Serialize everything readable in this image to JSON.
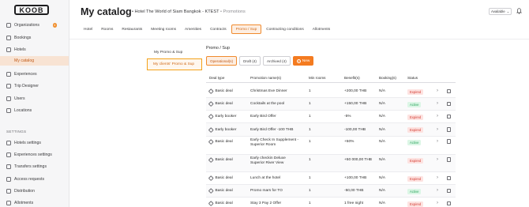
{
  "app": {
    "logo_text": "KOOB"
  },
  "sidebar": {
    "items": [
      {
        "label": "Organizations",
        "icon": "building-icon",
        "badge": "4"
      },
      {
        "label": "Bookings",
        "icon": "calendar-icon"
      },
      {
        "label": "Hotels",
        "icon": "hotel-icon"
      },
      {
        "label": "My catalog",
        "icon": "",
        "active": true
      },
      {
        "label": "Experiences",
        "icon": "compass-icon"
      },
      {
        "label": "Trip Designer",
        "icon": "map-icon"
      },
      {
        "label": "Users",
        "icon": "user-icon"
      },
      {
        "label": "Locations",
        "icon": "pin-icon"
      }
    ],
    "settings_label": "SETTINGS",
    "settings_items": [
      {
        "label": "Hotels settings",
        "icon": "hotel-settings-icon"
      },
      {
        "label": "Experiences settings",
        "icon": "experience-settings-icon"
      },
      {
        "label": "Transfers settings",
        "icon": "transfer-icon"
      },
      {
        "label": "Access requests",
        "icon": "key-icon"
      },
      {
        "label": "Distribution",
        "icon": "share-icon"
      },
      {
        "label": "Allotments",
        "icon": "allotment-icon"
      }
    ]
  },
  "header": {
    "title": "My catalog",
    "subtitle_prefix": "• Hotel The World of Siam Bangkok - KTEST",
    "subtitle_suffix": "• Promotions",
    "availability": "Available",
    "bell_icon": "bell-icon"
  },
  "tabs": [
    "Hotel",
    "Rooms",
    "Restaurants",
    "Meeting rooms",
    "Amenities",
    "Contracts",
    "Promo / Sup",
    "Contracting conditions",
    "Allotments"
  ],
  "active_tab": "Promo / Sup",
  "subnav": {
    "item1": "My Promo & Sup",
    "item2": "My clients' Promo & Sup"
  },
  "section": {
    "title": "Promo / Sup",
    "filters": [
      "Operational(s)",
      "Draft (4)",
      "Archived (4)"
    ],
    "new_button": "New"
  },
  "table": {
    "columns": [
      "Deal type",
      "Promotion name(s)",
      "Min rooms",
      "Benefit(s)",
      "Booking(s)",
      "Status"
    ],
    "rows": [
      {
        "deal": "Basic deal",
        "name": "Christmas Eve Dinner",
        "min": "1",
        "benefit": "+200,00 THB",
        "bookings": "N/A",
        "status": "Expired"
      },
      {
        "deal": "Basic deal",
        "name": "Cocktails at the pool",
        "min": "1",
        "benefit": "+150,00 THB",
        "bookings": "N/A",
        "status": "Active"
      },
      {
        "deal": "Early booker",
        "name": "Early Bird Offer",
        "min": "1",
        "benefit": "-5%",
        "bookings": "N/A",
        "status": "Expired"
      },
      {
        "deal": "Early booker",
        "name": "Early Bird Offer -100 THB",
        "min": "1",
        "benefit": "-100,00 THB",
        "bookings": "N/A",
        "status": "Expired"
      },
      {
        "deal": "Basic deal",
        "name": "Early Check In Supplement -",
        "name2": "Superior Room",
        "min": "1",
        "benefit": "+50%",
        "bookings": "N/A",
        "status": "Active"
      },
      {
        "deal": "Basic deal",
        "name": "Early checkin Deluxe",
        "name2": "Superior River View",
        "min": "1",
        "benefit": "+50 000,00 THB",
        "bookings": "N/A",
        "status": "Expired"
      },
      {
        "deal": "Basic deal",
        "name": "Lunch at the hotel",
        "min": "1",
        "benefit": "+100,00 THB",
        "bookings": "N/A",
        "status": "Expired"
      },
      {
        "deal": "Basic deal",
        "name": "Promo mars for TO",
        "min": "1",
        "benefit": "-50,00 THB",
        "bookings": "N/A",
        "status": "Active"
      },
      {
        "deal": "Basic deal",
        "name": "Stay 3 Pay 2 Offer",
        "min": "1",
        "benefit": "1 free night",
        "bookings": "N/A",
        "status": "Expired"
      }
    ]
  }
}
